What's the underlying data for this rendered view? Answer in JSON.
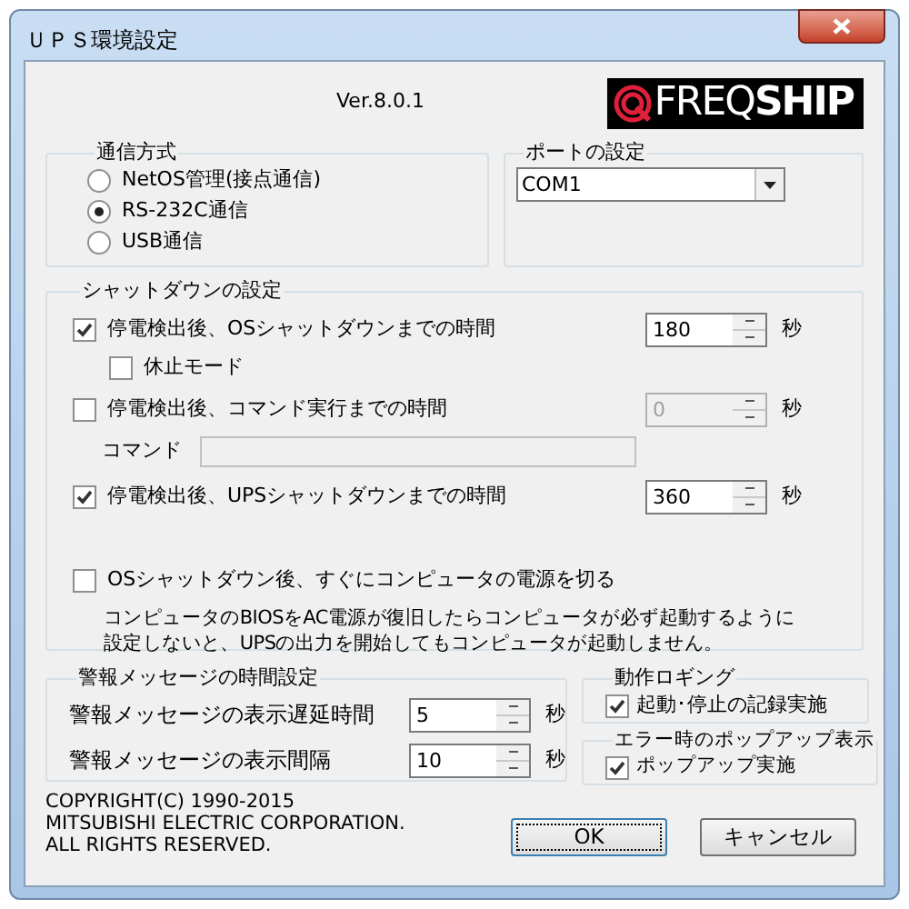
{
  "window": {
    "title": "ＵＰＳ環境設定"
  },
  "version": "Ver.8.0.1",
  "logo": {
    "light": "FREQ",
    "bold": "SHIP"
  },
  "communication": {
    "title": "通信方式",
    "options": [
      {
        "label": "NetOS管理(接点通信)",
        "selected": false
      },
      {
        "label": "RS-232C通信",
        "selected": true
      },
      {
        "label": "USB通信",
        "selected": false
      }
    ]
  },
  "port": {
    "title": "ポートの設定",
    "value": "COM1"
  },
  "shutdown": {
    "title": "シャットダウンの設定",
    "items": [
      {
        "kind": "timer",
        "label": "停電検出後、OSシャットダウンまでの時間",
        "checked": true,
        "value": "180",
        "unit": "秒",
        "disabled": false
      },
      {
        "kind": "subcheck",
        "label": "休止モード",
        "checked": false
      },
      {
        "kind": "timer",
        "label": "停電検出後、コマンド実行までの時間",
        "checked": false,
        "value": "0",
        "unit": "秒",
        "disabled": true
      },
      {
        "kind": "command",
        "label": "コマンド",
        "disabled": true
      },
      {
        "kind": "timer",
        "label": "停電検出後、UPSシャットダウンまでの時間",
        "checked": true,
        "value": "360",
        "unit": "秒",
        "disabled": false
      },
      {
        "kind": "check",
        "label": "OSシャットダウン後、すぐにコンピュータの電源を切る",
        "checked": false
      },
      {
        "kind": "note",
        "lines": [
          "コンピュータのBIOSをAC電源が復旧したらコンピュータが必ず起動するように",
          "設定しないと、UPSの出力を開始してもコンピュータが起動しません。"
        ]
      }
    ]
  },
  "alarm": {
    "title": "警報メッセージの時間設定",
    "items": [
      {
        "label": "警報メッセージの表示遅延時間",
        "value": "5",
        "unit": "秒"
      },
      {
        "label": "警報メッセージの表示間隔",
        "value": "10",
        "unit": "秒"
      }
    ]
  },
  "logging": {
    "title": "動作ロギング",
    "label": "起動･停止の記録実施",
    "checked": true
  },
  "popup": {
    "title": "エラー時のポップアップ表示",
    "label": "ポップアップ実施",
    "checked": true
  },
  "copyright": "COPYRIGHT(C) 1990-2015\nMITSUBISHI ELECTRIC CORPORATION.\nALL RIGHTS RESERVED.",
  "buttons": [
    {
      "label": "OK",
      "focused": true
    },
    {
      "label": "キャンセル",
      "focused": false
    }
  ]
}
